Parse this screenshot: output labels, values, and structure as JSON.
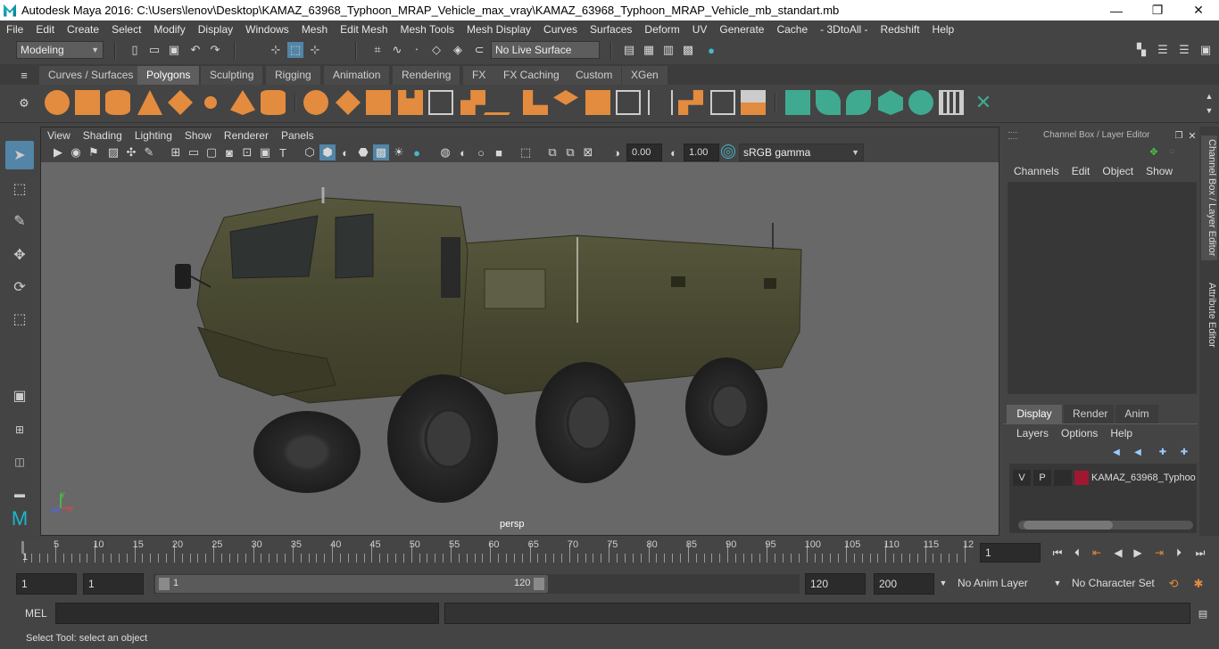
{
  "window": {
    "title": "Autodesk Maya 2016: C:\\Users\\lenov\\Desktop\\KAMAZ_63968_Typhoon_MRAP_Vehicle_max_vray\\KAMAZ_63968_Typhoon_MRAP_Vehicle_mb_standart.mb",
    "minimize": "—",
    "restore": "❐",
    "close": "✕"
  },
  "menubar": [
    "File",
    "Edit",
    "Create",
    "Select",
    "Modify",
    "Display",
    "Windows",
    "Mesh",
    "Edit Mesh",
    "Mesh Tools",
    "Mesh Display",
    "Curves",
    "Surfaces",
    "Deform",
    "UV",
    "Generate",
    "Cache",
    "- 3DtoAll -",
    "Redshift",
    "Help"
  ],
  "statusline": {
    "mode": "Modeling",
    "live_surface": "No Live Surface"
  },
  "shelf_tabs": [
    "Curves / Surfaces",
    "Polygons",
    "Sculpting",
    "Rigging",
    "Animation",
    "Rendering",
    "FX",
    "FX Caching",
    "Custom",
    "XGen"
  ],
  "shelf_active": "Polygons",
  "viewport": {
    "menu": [
      "View",
      "Shading",
      "Lighting",
      "Show",
      "Renderer",
      "Panels"
    ],
    "exposure": "0.00",
    "gamma": "1.00",
    "color_space": "sRGB gamma",
    "camera_label": "persp",
    "axis_y": "y",
    "axis_x": "x",
    "axis_z": "z"
  },
  "channel_box": {
    "title": "Channel Box / Layer Editor",
    "menu": [
      "Channels",
      "Edit",
      "Object",
      "Show"
    ]
  },
  "layer_editor": {
    "tabs": [
      "Display",
      "Render",
      "Anim"
    ],
    "menu": [
      "Layers",
      "Options",
      "Help"
    ],
    "layer": {
      "v": "V",
      "p": "P",
      "name": "KAMAZ_63968_Typhoo",
      "color": "#a0182f"
    }
  },
  "vertical_tabs": [
    "Channel Box / Layer Editor",
    "Attribute Editor"
  ],
  "timeline": {
    "ticks": [
      "5",
      "10",
      "15",
      "20",
      "25",
      "30",
      "35",
      "40",
      "45",
      "50",
      "55",
      "60",
      "65",
      "70",
      "75",
      "80",
      "85",
      "90",
      "95",
      "100",
      "105",
      "110",
      "115",
      "12"
    ],
    "start_marker": "1",
    "current_frame": "1"
  },
  "range": {
    "start": "1",
    "playback_start": "1",
    "slider_start": "1",
    "slider_end": "120",
    "playback_end": "120",
    "end": "200",
    "anim_layer": "No Anim Layer",
    "character_set": "No Character Set"
  },
  "cmdline": {
    "label": "MEL"
  },
  "helpline": {
    "text": "Select Tool: select an object"
  },
  "colors": {
    "accent": "#5285a6",
    "shelf_orange": "#e38b3e",
    "shelf_teal": "#3faa8f",
    "vehicle_olive": "#4a4a30"
  }
}
